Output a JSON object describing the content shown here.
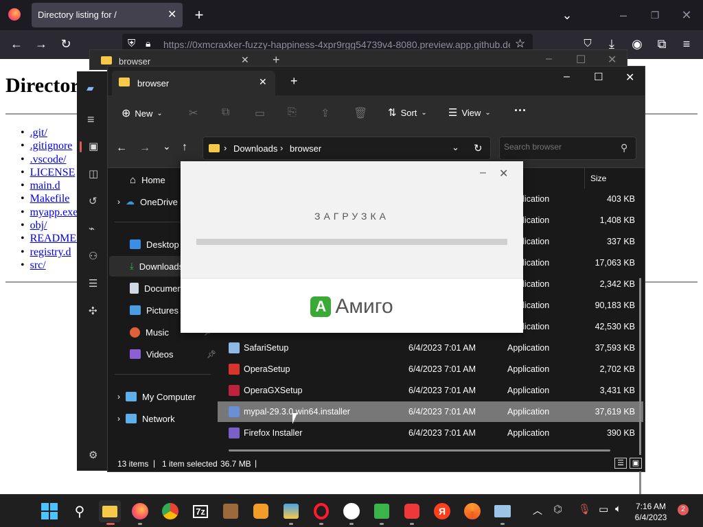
{
  "browser": {
    "tab_title": "Directory listing for /",
    "url": "https://0xmcraxker-fuzzy-happiness-4xpr9rgg54739v4-8080.preview.app.github.dev"
  },
  "page": {
    "heading": "Directory listing for /",
    "entries": [
      ".git/",
      ".gitignore",
      ".vscode/",
      "LICENSE",
      "main.d",
      "Makefile",
      "myapp.exe",
      "obj/",
      "README.md",
      "registry.d",
      "src/"
    ]
  },
  "back_window": {
    "tab_label": "browser"
  },
  "explorer": {
    "tab_label": "browser",
    "commands": {
      "new": "New",
      "sort": "Sort",
      "view": "View"
    },
    "breadcrumb": [
      "Downloads",
      "browser"
    ],
    "search_placeholder": "Search browser",
    "size_header": "Size",
    "nav": {
      "home": "Home",
      "onedrive": "OneDrive",
      "desktop": "Desktop",
      "downloads": "Downloads",
      "documents": "Documents",
      "pictures": "Pictures",
      "music": "Music",
      "videos": "Videos",
      "mycomputer": "My Computer",
      "network": "Network"
    },
    "rows": [
      {
        "name": "",
        "date": "",
        "type": "Application",
        "size": "403 KB"
      },
      {
        "name": "",
        "date": "",
        "type": "Application",
        "size": "1,408 KB"
      },
      {
        "name": "",
        "date": "",
        "type": "Application",
        "size": "337 KB"
      },
      {
        "name": "",
        "date": "",
        "type": "Application",
        "size": "17,063 KB"
      },
      {
        "name": "",
        "date": "",
        "type": "Application",
        "size": "2,342 KB"
      },
      {
        "name": "",
        "date": "",
        "type": "Application",
        "size": "90,183 KB"
      },
      {
        "name": "",
        "date": "",
        "type": "Application",
        "size": "42,530 KB"
      },
      {
        "name": "SafariSetup",
        "date": "6/4/2023 7:01 AM",
        "type": "Application",
        "size": "37,593 KB"
      },
      {
        "name": "OperaSetup",
        "date": "6/4/2023 7:01 AM",
        "type": "Application",
        "size": "2,702 KB"
      },
      {
        "name": "OperaGXSetup",
        "date": "6/4/2023 7:01 AM",
        "type": "Application",
        "size": "3,431 KB"
      },
      {
        "name": "mypal-29.3.0.win64.installer",
        "date": "6/4/2023 7:01 AM",
        "type": "Application",
        "size": "37,619 KB"
      },
      {
        "name": "Firefox Installer",
        "date": "6/4/2023 7:01 AM",
        "type": "Application",
        "size": "390 KB"
      }
    ],
    "status": {
      "items": "13 items",
      "selected": "1 item selected",
      "size": "36.7 MB"
    }
  },
  "amigo": {
    "loading": "ЗАГРУЗКА",
    "brand": "Амиго",
    "logo_letter": "A"
  },
  "taskbar": {
    "time": "7:16 AM",
    "date": "6/4/2023",
    "badge": "2",
    "app_7z": "7z",
    "app_ya": "Я"
  }
}
